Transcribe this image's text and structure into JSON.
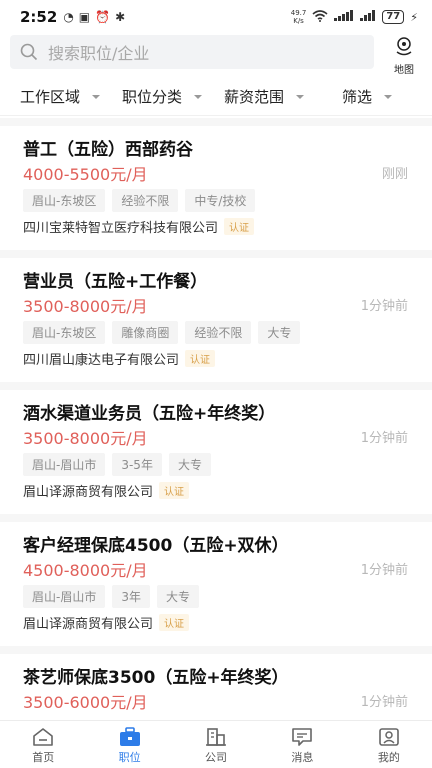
{
  "status_bar": {
    "time": "2:52",
    "net_speed_value": "49.7",
    "net_speed_unit": "K/s",
    "battery": "77"
  },
  "search": {
    "placeholder": "搜索职位/企业",
    "map_label": "地图"
  },
  "filters": [
    {
      "label": "工作区域"
    },
    {
      "label": "职位分类"
    },
    {
      "label": "薪资范围"
    },
    {
      "label": "筛选"
    }
  ],
  "jobs": [
    {
      "title": "普工（五险）西部药谷",
      "salary": "4000-5500元/月",
      "time": "刚刚",
      "tags": [
        "眉山-东坡区",
        "经验不限",
        "中专/技校"
      ],
      "company": "四川宝莱特智立医疗科技有限公司",
      "badge": "认证"
    },
    {
      "title": "营业员（五险+工作餐）",
      "salary": "3500-8000元/月",
      "time": "1分钟前",
      "tags": [
        "眉山-东坡区",
        "雕像商圈",
        "经验不限",
        "大专"
      ],
      "company": "四川眉山康达电子有限公司",
      "badge": "认证"
    },
    {
      "title": "酒水渠道业务员（五险+年终奖）",
      "salary": "3500-8000元/月",
      "time": "1分钟前",
      "tags": [
        "眉山-眉山市",
        "3-5年",
        "大专"
      ],
      "company": "眉山译源商贸有限公司",
      "badge": "认证"
    },
    {
      "title": "客户经理保底4500（五险+双休）",
      "salary": "4500-8000元/月",
      "time": "1分钟前",
      "tags": [
        "眉山-眉山市",
        "3年",
        "大专"
      ],
      "company": "眉山译源商贸有限公司",
      "badge": "认证"
    },
    {
      "title": "茶艺师保底3500（五险+年终奖）",
      "salary": "3500-6000元/月",
      "time": "1分钟前",
      "tags": [],
      "company": "",
      "badge": ""
    }
  ],
  "tabs": [
    {
      "label": "首页",
      "icon": "home-icon"
    },
    {
      "label": "职位",
      "icon": "briefcase-icon",
      "active": true
    },
    {
      "label": "公司",
      "icon": "building-icon"
    },
    {
      "label": "消息",
      "icon": "message-icon"
    },
    {
      "label": "我的",
      "icon": "profile-icon"
    }
  ],
  "colors": {
    "accent": "#2d7ce8",
    "salary": "#e0605a",
    "badge_text": "#d8a04a",
    "badge_bg": "#fdf5e6"
  }
}
